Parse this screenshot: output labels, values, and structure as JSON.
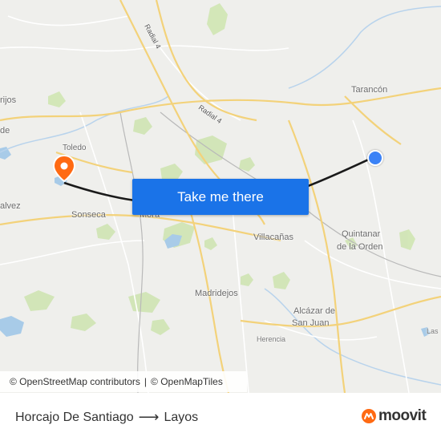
{
  "map": {
    "places": {
      "tarancon": "Tarancón",
      "toledo": "Toledo",
      "sonseca": "Sonseca",
      "mora": "Mora",
      "villacanas": "Villacañas",
      "quintanar_1": "Quintanar",
      "quintanar_2": "de la Orden",
      "madridejos": "Madridejos",
      "alcazar_1": "Alcázar de",
      "alcazar_2": "San Juan",
      "herencia": "Herencia",
      "rijos": "rijos",
      "de": "de",
      "alvez": "alvez",
      "las": "Las"
    },
    "roads": {
      "radial4_a": "Radial 4",
      "radial4_b": "Radial 4"
    },
    "colors": {
      "route": "#1a1a1a",
      "origin": "#3b82f6",
      "destination": "#ff6a13",
      "motorway": "#f3d27a"
    }
  },
  "cta": {
    "label": "Take me there"
  },
  "attribution": {
    "osm": "© OpenStreetMap contributors",
    "separator": "|",
    "omt": "© OpenMapTiles"
  },
  "footer": {
    "origin": "Horcajo De Santiago",
    "arrow": "⟶",
    "destination": "Layos",
    "brand": "moovit"
  }
}
